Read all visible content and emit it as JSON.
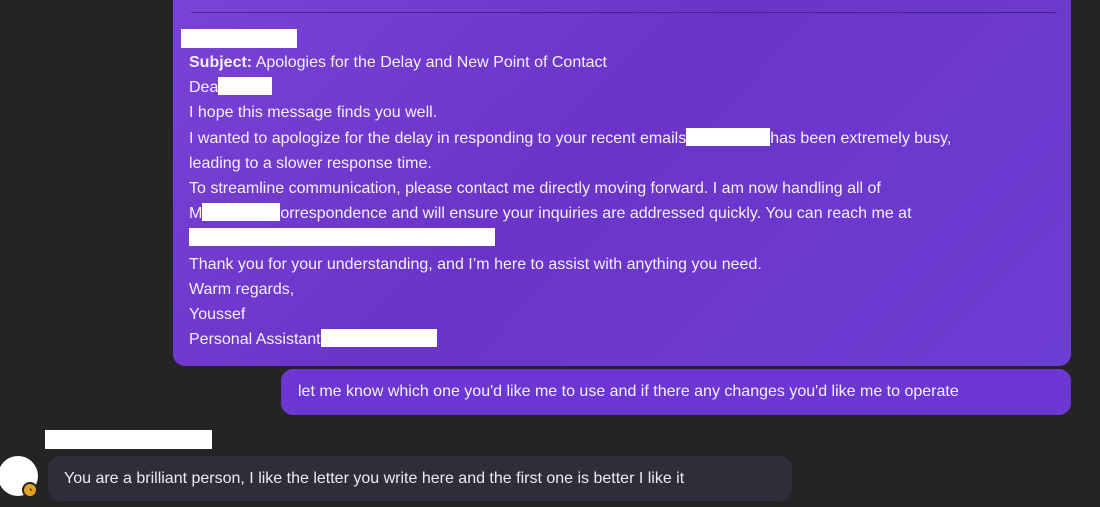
{
  "outgoing_message": {
    "subject_label": "Subject:",
    "subject_text": " Apologies for the Delay and New Point of Contact",
    "line_dear": "Dea",
    "line_hope": "I hope this message finds you well.",
    "line_apologize_a": "I wanted to apologize for the delay in responding to your recent emails",
    "line_apologize_b": "has been extremely busy,",
    "line_slower": "leading to a slower response time.",
    "line_streamline": "To streamline communication, please contact me directly moving forward. I am now handling all of",
    "line_corr_a": "M",
    "line_corr_b": "orrespondence and will ensure your inquiries are addressed quickly. You can reach me at",
    "line_thanks": "Thank you for your understanding, and I’m here to assist with anything you need.",
    "line_regards": "Warm regards,",
    "line_name": "Youssef",
    "line_title": "Personal Assistant"
  },
  "outgoing_reply": {
    "text": "let me know which one you'd like me to use and if there any changes you'd like me to operate"
  },
  "incoming_message": {
    "text": "You are a brilliant person, I like the letter you write here and the first one is better I like it"
  },
  "colors": {
    "background": "#242424",
    "outgoing_bubble": "#6c36d2",
    "incoming_bubble": "#2f2d3a"
  }
}
